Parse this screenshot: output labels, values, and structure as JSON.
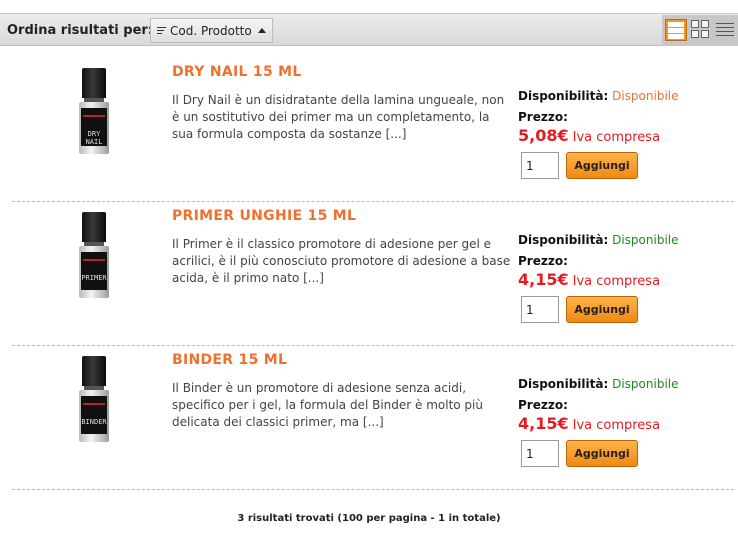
{
  "toolbar": {
    "sort_label": "Ordina risultati per:",
    "sort_value": "Cod. Prodotto",
    "icons": {
      "sort": "sort-lines-icon",
      "direction": "caret-up-icon",
      "list_view": "list-view-icon",
      "grid_view": "grid-view-icon",
      "compact_view": "compact-list-icon"
    },
    "active_view_color": "#f7941d"
  },
  "products": [
    {
      "title": "DRY NAIL 15 ML",
      "bottle_label": "DRY NAIL",
      "description": "Il Dry Nail è un disidratante della lamina ungueale, non è un sostitutivo dei primer ma un completamento, la sua formula composta da sostanze [...]",
      "availability_label": "Disponibilità:",
      "availability": "Disponibile",
      "availability_color": "#f0712d",
      "price_label": "Prezzo:",
      "price": "5,08€",
      "vat": "Iva compresa",
      "quantity": "1",
      "add_label": "Aggiungi"
    },
    {
      "title": "PRIMER UNGHIE 15 ML",
      "bottle_label": "PRIMER",
      "description": "Il Primer è il classico promotore di adesione per gel e acrilici, è il più conosciuto promotore di adesione a base acida, è il primo nato [...]",
      "availability_label": "Disponibilità:",
      "availability": "Disponibile",
      "availability_color": "#1e8c1e",
      "price_label": "Prezzo:",
      "price": "4,15€",
      "vat": "Iva compresa",
      "quantity": "1",
      "add_label": "Aggiungi"
    },
    {
      "title": "BINDER 15 ML",
      "bottle_label": "BINDER",
      "description": "Il Binder è un promotore di adesione senza acidi, specifico per i gel, la formula del Binder è molto più delicata dei classici primer, ma [...]",
      "availability_label": "Disponibilità:",
      "availability": "Disponibile",
      "availability_color": "#1e8c1e",
      "price_label": "Prezzo:",
      "price": "4,15€",
      "vat": "Iva compresa",
      "quantity": "1",
      "add_label": "Aggiungi"
    }
  ],
  "footer": {
    "results_text": "3 risultati trovati (100 per pagina - 1 in totale)"
  },
  "colors": {
    "title": "#f0712d",
    "price": "#e31b23",
    "button": "#f08a12"
  }
}
